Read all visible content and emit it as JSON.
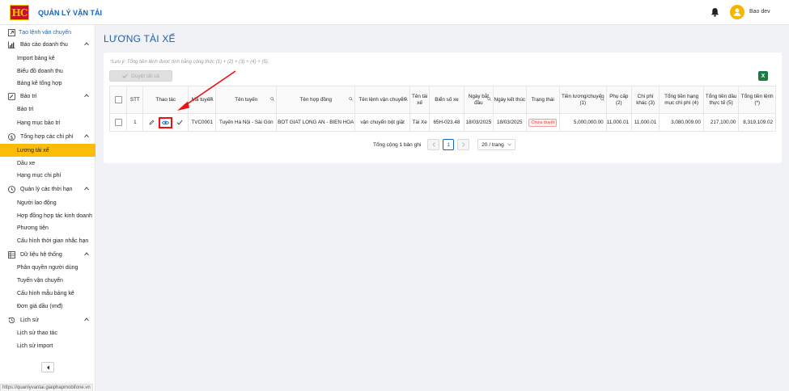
{
  "app": {
    "title": "QUẢN LÝ VẬN TẢI",
    "logo_text": "HC",
    "user_name": "Bao dev"
  },
  "sidebar": {
    "top_item": "Tạo lệnh vận chuyển",
    "groups": [
      {
        "label": "Báo cáo doanh thu",
        "icon": "chart-icon",
        "items": [
          "Import bảng kê",
          "Biểu đồ doanh thu",
          "Bảng kê tổng hợp"
        ]
      },
      {
        "label": "Bảo trì",
        "icon": "wrench-icon",
        "items": [
          "Bảo trì",
          "Hạng mục bảo trì"
        ]
      },
      {
        "label": "Tổng hợp các chi phí",
        "icon": "dollar-icon",
        "items": [
          "Lương tài xế",
          "Dầu xe",
          "Hạng mục chi phí"
        ]
      },
      {
        "label": "Quản lý các thời hạn",
        "icon": "clock-icon",
        "items": [
          "Người lao động",
          "Hợp đồng hợp tác kinh doanh",
          "Phương tiện",
          "Cấu hình thời gian nhắc hạn"
        ]
      },
      {
        "label": "Dữ liệu hệ thống",
        "icon": "database-icon",
        "items": [
          "Phân quyền người dùng",
          "Tuyến vận chuyển",
          "Cấu hình mẫu bảng kê",
          "Đơn giá dầu (vnđ)"
        ]
      },
      {
        "label": "Lịch sử",
        "icon": "history-icon",
        "items": [
          "Lịch sử thao tác",
          "Lịch sử import"
        ]
      }
    ],
    "active_item": "Lương tài xế"
  },
  "status_url": "https://quanlyvantai.giaiphapmobifone.vn",
  "page": {
    "title": "LƯƠNG TÀI XẾ",
    "note": "*Lưu ý: Tổng tiền lệnh được tính bằng công thức (1) + (2) + (3) + (4) + (5).",
    "approve_all": "Duyệt tất cả"
  },
  "table": {
    "headers": [
      "STT",
      "Thao tác",
      "Mã tuyến",
      "Tên tuyến",
      "Tên hợp đồng",
      "Tên lệnh vận chuyển",
      "Tên tài xế",
      "Biển số xe",
      "Ngày bắt đầu",
      "Ngày kết thúc",
      "Trạng thái",
      "Tiền lương/chuyến (1)",
      "Phụ cấp (2)",
      "Chi phí khác (3)",
      "Tổng tiền hạng mục chi phí (4)",
      "Tổng tiền dầu thực tế (5)",
      "Tổng tiền lệnh (*)"
    ],
    "rows": [
      {
        "stt": "1",
        "ma_tuyen": "TVC0001",
        "ten_tuyen": "Tuyến Hà Nội - Sài Gòn",
        "ten_hop_dong": "BOT GIAT LONG AN - BIEN HOA",
        "ten_lenh": "vận chuyển bột giặt",
        "ten_tai_xe": "Tài Xe",
        "bien_so": "65H-023.48",
        "ngay_bat_dau": "18/03/2025",
        "ngay_ket_thuc": "18/03/2025",
        "trang_thai": "Chưa duyệt",
        "tien_luong": "5,000,000.00",
        "phu_cap": "11,000.01",
        "chi_phi_khac": "11,000.01",
        "tong_hang_muc": "3,080,009.00",
        "tong_dau": "217,100.00",
        "tong_lenh": "8,319,109.02"
      }
    ]
  },
  "pagination": {
    "total_text": "Tổng cộng 1 bản ghi",
    "current_page": "1",
    "page_size": "20 / trang"
  },
  "colors": {
    "accent": "#1565c0",
    "active_menu": "#fbbd08",
    "highlight": "#e11111",
    "excel": "#1d7a43"
  }
}
